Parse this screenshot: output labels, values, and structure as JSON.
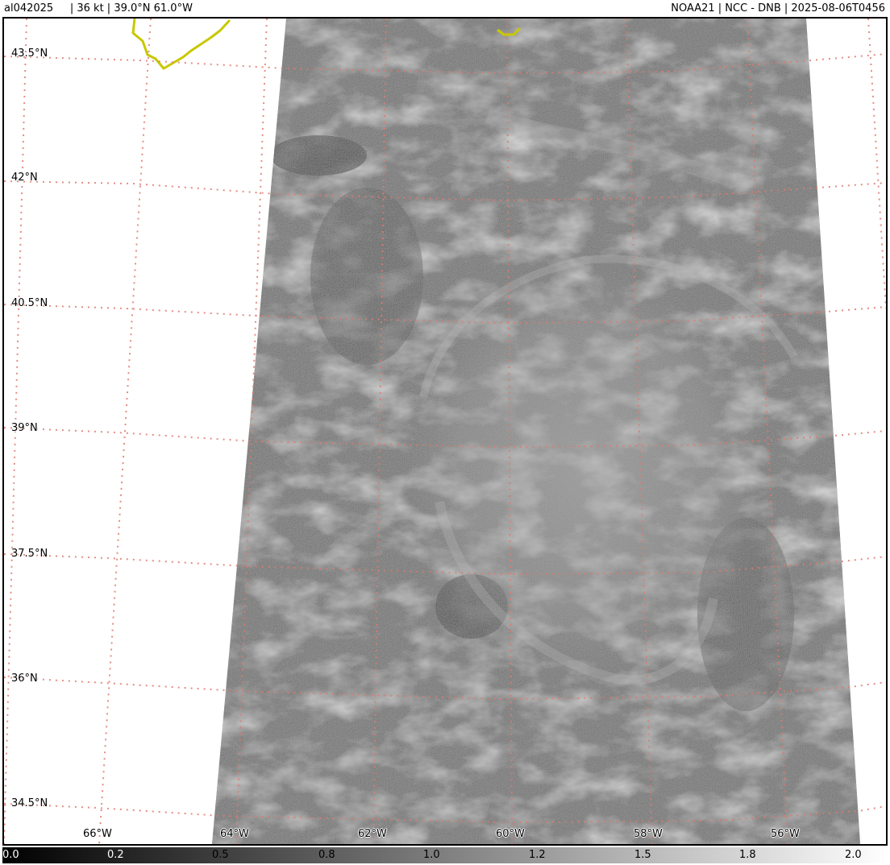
{
  "header": {
    "left": "al042025     | 36 kt | 39.0°N 61.0°W",
    "right": "NOAA21 | NCC - DNB | 2025-08-06T0456"
  },
  "map": {
    "storm_id": "al042025",
    "intensity": "36 kt",
    "center": "39.0°N 61.0°W",
    "satellite": "NOAA21",
    "product": "NCC - DNB",
    "time": "2025-08-06T0456",
    "lat_labels": [
      "43.5°N",
      "42°N",
      "40.5°N",
      "39°N",
      "37.5°N",
      "36°N",
      "34.5°N"
    ],
    "lon_labels": [
      "66°W",
      "64°W",
      "62°W",
      "60°W",
      "58°W",
      "56°W"
    ],
    "gridline_color": "#e07a6e",
    "coastline_color": "#c8c800",
    "colorbar": {
      "ticks": [
        "0.0",
        "0.2",
        "0.5",
        "0.8",
        "1.0",
        "1.2",
        "1.5",
        "1.8",
        "2.0"
      ],
      "min": 0.0,
      "max": 2.0
    }
  }
}
